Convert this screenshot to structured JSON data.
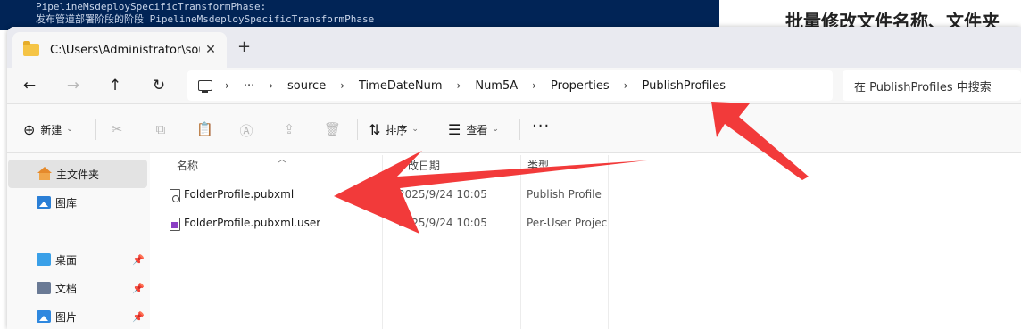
{
  "terminal": {
    "lines": [
      "PipelineMsdeploySpecificTransformPhase:",
      "  发布管道部署阶段的阶段 PipelineMsdeploySpecificTransformPhase"
    ]
  },
  "doc": {
    "title": "批量修改文件名称、文件夹"
  },
  "tab": {
    "label": "C:\\Users\\Administrator\\source",
    "close": "✕",
    "new": "+"
  },
  "nav": {
    "back": "←",
    "forward": "→",
    "up": "↑",
    "refresh": "↻",
    "more": "···"
  },
  "breadcrumbs": [
    "source",
    "TimeDateNum",
    "Num5A",
    "Properties",
    "PublishProfiles"
  ],
  "search": {
    "placeholder": "在 PublishProfiles 中搜索"
  },
  "toolbar": {
    "new_label": "新建",
    "sort_label": "排序",
    "view_label": "查看",
    "more": "···"
  },
  "sidebar": {
    "items": [
      {
        "label": "主文件夹",
        "icon": "home-icon",
        "selected": true
      },
      {
        "label": "图库",
        "icon": "gallery-icon"
      },
      {
        "label": "桌面",
        "icon": "desktop-icon",
        "pinned": true
      },
      {
        "label": "文档",
        "icon": "documents-icon",
        "pinned": true
      },
      {
        "label": "图片",
        "icon": "pictures-icon",
        "pinned": true
      }
    ]
  },
  "columns": {
    "name": "名称",
    "date": "改日期",
    "type": "类型"
  },
  "files": [
    {
      "name": "FolderProfile.pubxml",
      "date": "2025/9/24 10:05",
      "type": "Publish Profile",
      "icon": "publish-profile-icon"
    },
    {
      "name": "FolderProfile.pubxml.user",
      "date": "2025/9/24 10:05",
      "type": "Per-User Project",
      "icon": "vs-user-file-icon"
    }
  ],
  "colors": {
    "annotation_arrow": "#f23a3a",
    "terminal_bg": "#012456",
    "folder": "#f5c445"
  }
}
